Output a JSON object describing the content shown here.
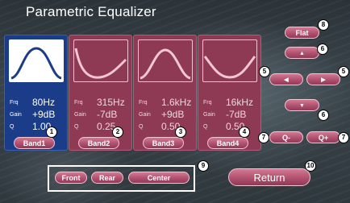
{
  "header": {
    "title": "Parametric Equalizer"
  },
  "bands": [
    {
      "frq_label": "Frq",
      "gain_label": "Gain",
      "q_label": "Q",
      "frq": "80Hz",
      "gain": "+9dB",
      "q": "1.00",
      "button": "Band1",
      "callout": "1"
    },
    {
      "frq_label": "Frq",
      "gain_label": "Gain",
      "q_label": "Q",
      "frq": "315Hz",
      "gain": "-7dB",
      "q": "0.25",
      "button": "Band2",
      "callout": "2"
    },
    {
      "frq_label": "Frq",
      "gain_label": "Gain",
      "q_label": "Q",
      "frq": "1.6kHz",
      "gain": "+9dB",
      "q": "0.50",
      "button": "Band3",
      "callout": "3"
    },
    {
      "frq_label": "Frq",
      "gain_label": "Gain",
      "q_label": "Q",
      "frq": "16kHz",
      "gain": "-7dB",
      "q": "0.50",
      "button": "Band4",
      "callout": "4"
    }
  ],
  "controls": {
    "flat": "Flat",
    "up_glyph": "▲",
    "down_glyph": "▼",
    "left_glyph": "◀",
    "right_glyph": "▶",
    "q_minus": "Q-",
    "q_plus": "Q+"
  },
  "modes": {
    "front": "Front",
    "rear": "Rear",
    "center": "Center"
  },
  "return_label": "Return",
  "callouts": {
    "flat": "8",
    "up": "6",
    "left_outer": "5",
    "right_outer": "5",
    "down": "6",
    "q_minus": "7",
    "q_plus": "7",
    "modes": "9",
    "return": "10"
  },
  "colors": {
    "active_band": "#1b3c88",
    "inactive_band": "#8e3a55",
    "button": "#b1506f"
  }
}
